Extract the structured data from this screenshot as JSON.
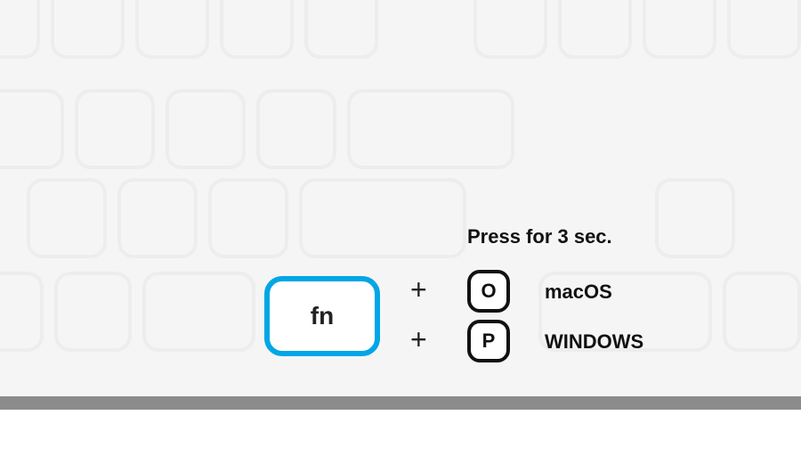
{
  "instruction": {
    "press_label": "Press for 3 sec.",
    "fn_key_label": "fn",
    "combo_symbol": "+",
    "shortcuts": [
      {
        "key": "O",
        "os": "macOS"
      },
      {
        "key": "P",
        "os": "WINDOWS"
      }
    ]
  },
  "colors": {
    "highlight": "#00a6e6",
    "ghost_key_border": "#ededed",
    "kbd_bg": "#f5f5f5",
    "kbd_edge": "#8b8b8b"
  }
}
